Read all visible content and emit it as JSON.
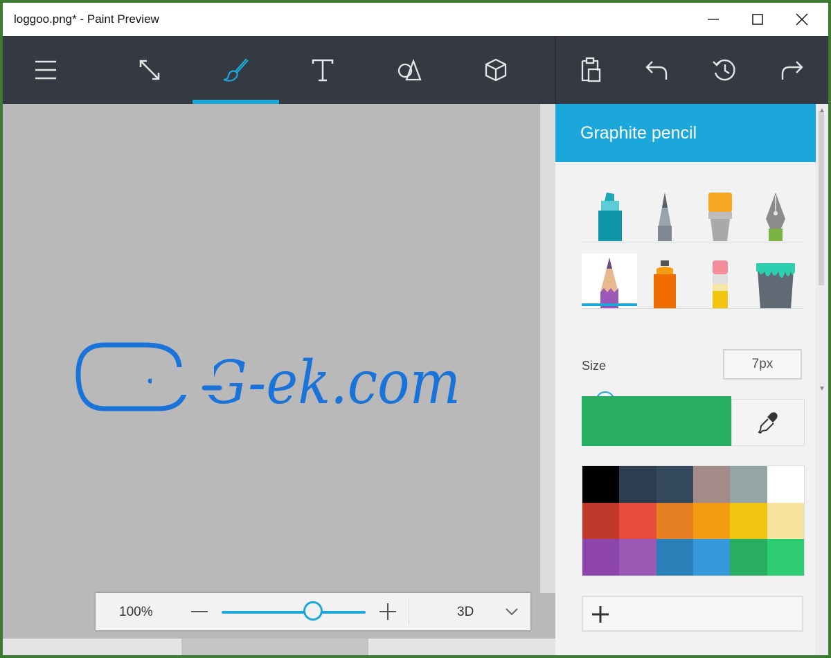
{
  "window": {
    "title": "loggoo.png* - Paint Preview"
  },
  "toolbar": {
    "items": [
      {
        "name": "menu",
        "icon": "hamburger-menu-icon"
      },
      {
        "name": "canvas",
        "icon": "expand-canvas-icon"
      },
      {
        "name": "brushes",
        "icon": "brush-icon",
        "selected": true
      },
      {
        "name": "text",
        "icon": "text-icon"
      },
      {
        "name": "2d-shapes",
        "icon": "shapes-icon"
      },
      {
        "name": "3d-objects",
        "icon": "cube-icon"
      },
      {
        "name": "paste",
        "icon": "paste-icon"
      },
      {
        "name": "undo",
        "icon": "undo-icon"
      },
      {
        "name": "history",
        "icon": "history-icon"
      },
      {
        "name": "redo",
        "icon": "redo-icon"
      }
    ],
    "accent": "#1ba7d9",
    "background": "#353941"
  },
  "canvas": {
    "logo_text": "G-ek.com",
    "logo_color": "#1a73d9",
    "background": "#b9b9b9"
  },
  "zoombar": {
    "zoom": "100%",
    "zoom_level": 0.5,
    "mode": "3D"
  },
  "panel": {
    "title": "Graphite pencil",
    "brushes": [
      {
        "name": "marker",
        "icon": "marker-icon"
      },
      {
        "name": "calligraphy-pen",
        "icon": "calligraphy-pen-icon"
      },
      {
        "name": "oil-brush",
        "icon": "oil-brush-icon"
      },
      {
        "name": "fountain-pen",
        "icon": "fountain-pen-icon"
      },
      {
        "name": "graphite-pencil",
        "icon": "pencil-icon",
        "selected": true
      },
      {
        "name": "spray-can",
        "icon": "spray-can-icon"
      },
      {
        "name": "eraser",
        "icon": "eraser-icon"
      },
      {
        "name": "fill",
        "icon": "paint-bucket-icon"
      }
    ],
    "size_label": "Size",
    "size_value": "7px",
    "current_color": "#27ae60",
    "palette": [
      "#000000",
      "#2c3e50",
      "#34495e",
      "#a38b88",
      "#95a5a6",
      "#ffffff",
      "#c0392b",
      "#e74c3c",
      "#e67e22",
      "#f39c12",
      "#f1c40f",
      "#f7e39c",
      "#8e44ad",
      "#9b59b6",
      "#2980b9",
      "#3498db",
      "#27ae60",
      "#2ecc71"
    ]
  }
}
